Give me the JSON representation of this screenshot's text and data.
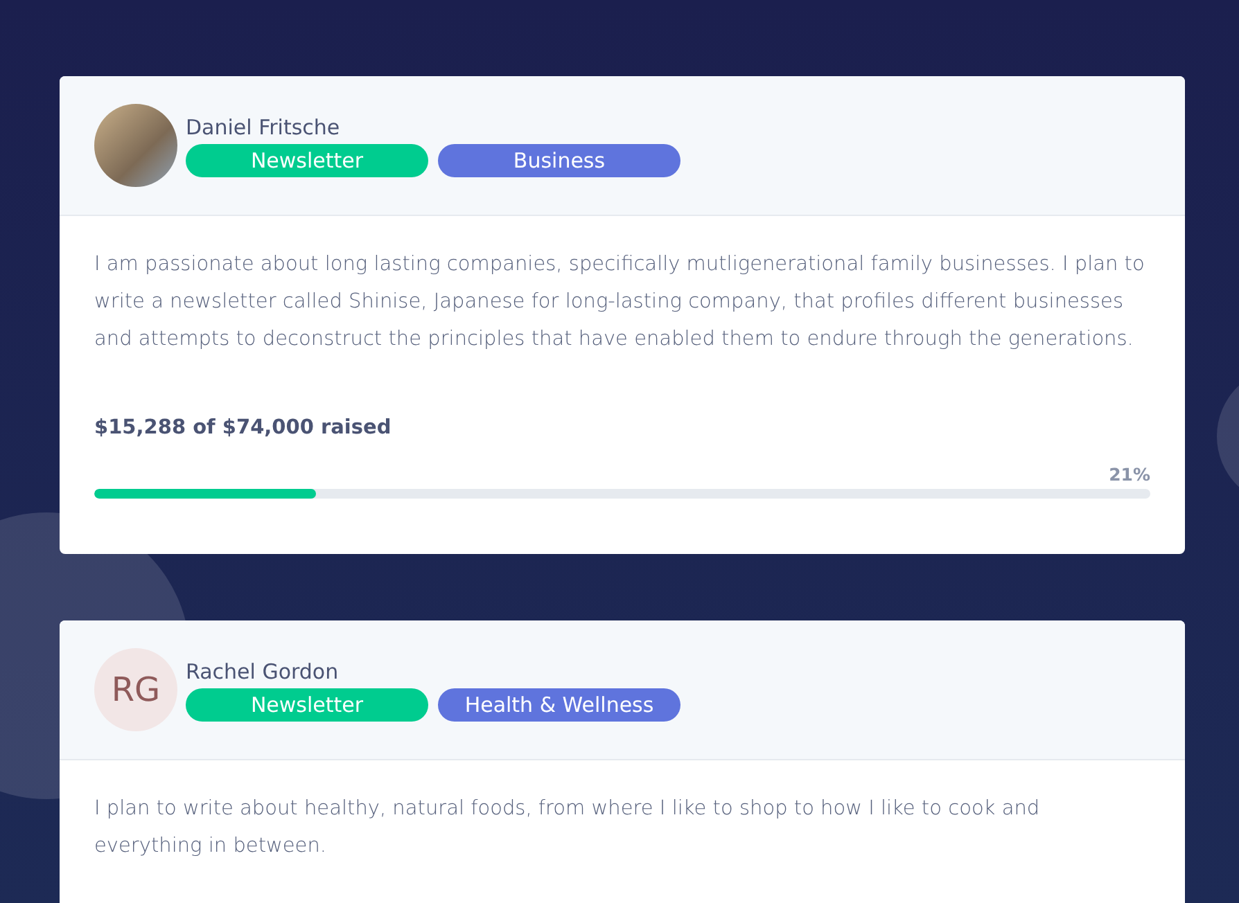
{
  "campaigns": [
    {
      "author": "Daniel Fritsche",
      "avatar": {
        "kind": "photo"
      },
      "tags": [
        {
          "label": "Newsletter",
          "color": "#00cc8f"
        },
        {
          "label": "Business",
          "color": "#5f74dd"
        }
      ],
      "description": "I am passionate about long lasting companies, specifically mutligenerational family businesses. I plan to write a newsletter called Shinise, Japanese for long-lasting company, that profiles different businesses and attempts to deconstruct the principles that have enabled them to endure through the generations.",
      "raised": "$15,288 of $74,000 raised",
      "percent": "21%",
      "level": 0.21
    },
    {
      "author": "Rachel Gordon",
      "avatar": {
        "kind": "initials",
        "text": "RG"
      },
      "tags": [
        {
          "label": "Newsletter",
          "color": "#00cc8f"
        },
        {
          "label": "Health & Wellness",
          "color": "#5f74dd"
        }
      ],
      "description": "I plan to write about healthy, natural foods, from where I like to shop to how I like to cook and everything in between."
    }
  ]
}
